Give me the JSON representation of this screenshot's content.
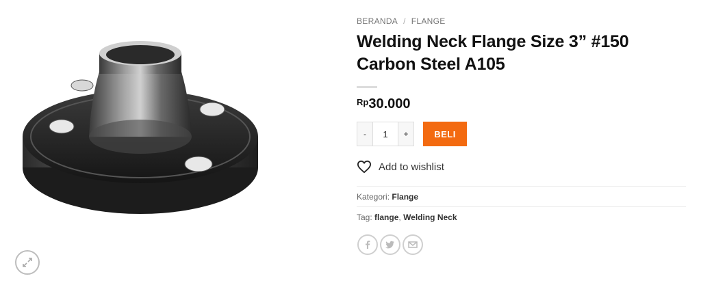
{
  "breadcrumb": {
    "home": "BERANDA",
    "separator": "/",
    "category": "FLANGE"
  },
  "product": {
    "title": "Welding Neck Flange Size 3” #150 Carbon Steel A105",
    "price_currency": "Rp",
    "price_amount": "30.000",
    "image_alt": "welding-neck-flange-photo"
  },
  "cart": {
    "minus": "-",
    "quantity": "1",
    "plus": "+",
    "buy_label": "BELI"
  },
  "wishlist": {
    "label": "Add to wishlist"
  },
  "meta": {
    "category_label": "Kategori:",
    "category_value": "Flange",
    "tags_label": "Tag:",
    "tags": [
      "flange",
      "Welding Neck"
    ],
    "tag_separator": ","
  },
  "share": {
    "icons": [
      "facebook-icon",
      "twitter-icon",
      "email-icon"
    ]
  },
  "colors": {
    "accent": "#f36a10",
    "text": "#111111",
    "muted": "#777777",
    "border": "#dddddd"
  }
}
